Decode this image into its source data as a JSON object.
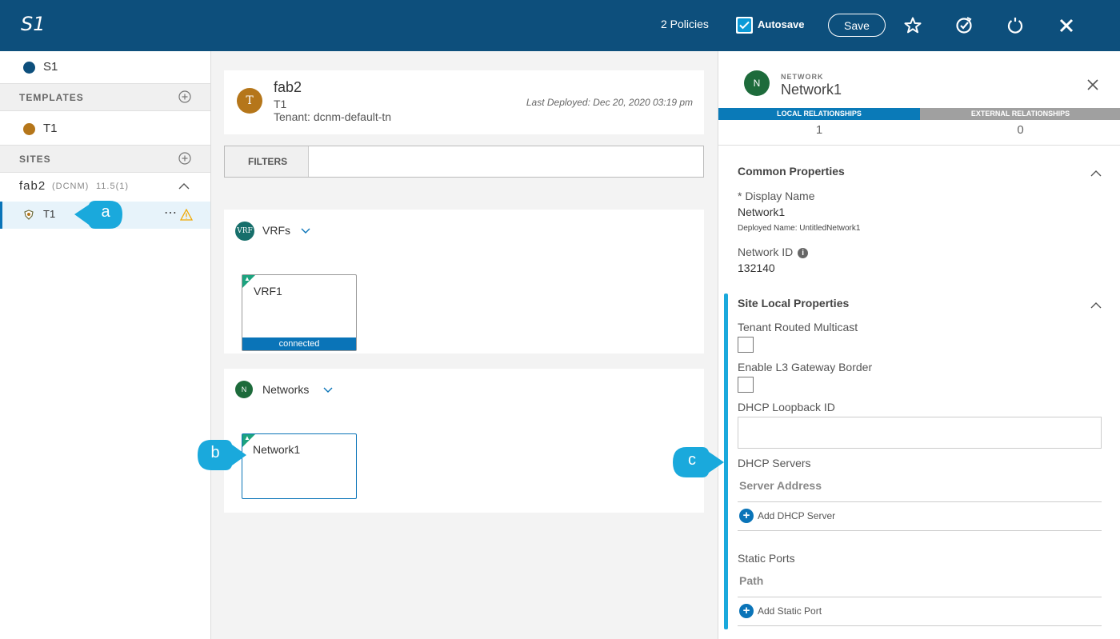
{
  "header": {
    "title": "S1",
    "policies": "2 Policies",
    "autosave_label": "Autosave",
    "save_label": "Save"
  },
  "sidebar": {
    "schema_item": "S1",
    "templates_label": "TEMPLATES",
    "template_item": "T1",
    "sites_label": "SITES",
    "site_name": "fab2",
    "site_type": "(DCNM)",
    "site_version": "11.5(1)",
    "site_template": "T1",
    "more_icon": "⋯"
  },
  "callouts": {
    "a": "a",
    "b": "b",
    "c": "c"
  },
  "center": {
    "site_avatar": "T",
    "site_name": "fab2",
    "template_name": "T1",
    "tenant": "Tenant: dcnm-default-tn",
    "last_deployed": "Last Deployed: Dec 20, 2020 03:19 pm",
    "filters_label": "FILTERS",
    "vrfs_badge": "VRF",
    "vrfs_label": "VRFs",
    "vrf_card_name": "VRF1",
    "vrf_card_status": "connected",
    "networks_badge": "N",
    "networks_label": "Networks",
    "network_card_name": "Network1"
  },
  "right": {
    "avatar": "N",
    "kind": "NETWORK",
    "name": "Network1",
    "tab_local": "LOCAL RELATIONSHIPS",
    "tab_external": "EXTERNAL RELATIONSHIPS",
    "local_count": "1",
    "external_count": "0",
    "common_title": "Common Properties",
    "display_name_label": "* Display Name",
    "display_name_value": "Network1",
    "deployed_name": "Deployed Name: UntitledNetwork1",
    "network_id_label": "Network ID",
    "network_id_value": "132140",
    "site_local_title": "Site Local Properties",
    "tenant_routed_multicast": "Tenant Routed Multicast",
    "enable_l3_gateway": "Enable L3 Gateway Border",
    "dhcp_loopback_label": "DHCP Loopback ID",
    "dhcp_servers_label": "DHCP Servers",
    "server_address_header": "Server Address",
    "add_dhcp_server": "Add DHCP Server",
    "static_ports_label": "Static Ports",
    "path_header": "Path",
    "add_static_port": "Add Static Port"
  },
  "colors": {
    "header_bg": "#0d4f7c",
    "accent": "#1aa9dc",
    "tab_active": "#0a7ab8",
    "template_orange": "#b5761a",
    "network_green": "#1d6b3b",
    "card_corner": "#1ca37f"
  }
}
